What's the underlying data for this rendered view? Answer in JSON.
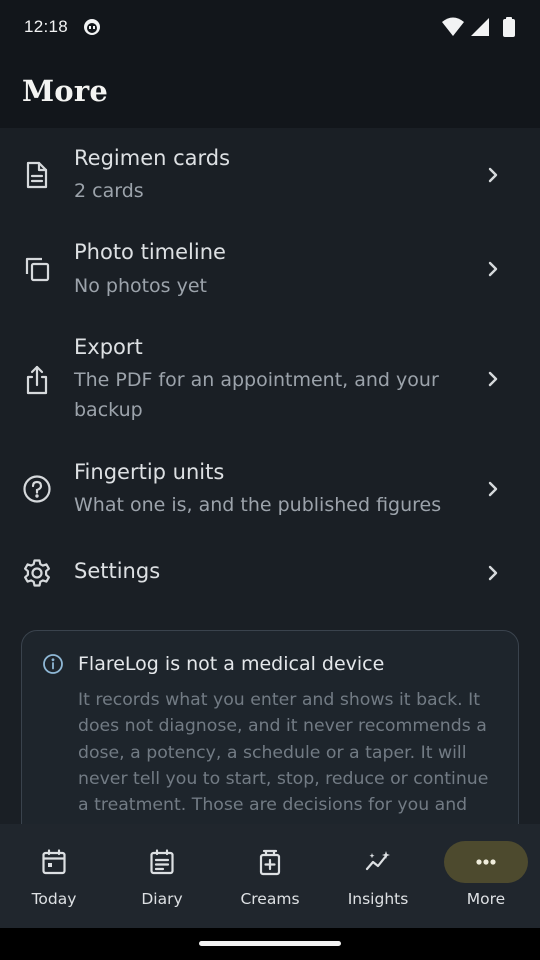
{
  "status_bar": {
    "time": "12:18",
    "icons": [
      "app-notification-icon",
      "wifi-icon",
      "cellular-signal-icon",
      "battery-icon"
    ]
  },
  "header": {
    "title": "More"
  },
  "menu": {
    "items": [
      {
        "title": "Regimen cards",
        "subtitle": "2 cards",
        "icon": "document-icon"
      },
      {
        "title": "Photo timeline",
        "subtitle": "No photos yet",
        "icon": "copy-stack-icon"
      },
      {
        "title": "Export",
        "subtitle": "The PDF for an appointment, and your backup",
        "icon": "share-upload-icon"
      },
      {
        "title": "Fingertip units",
        "subtitle": "What one is, and the published figures",
        "icon": "help-circle-icon"
      },
      {
        "title": "Settings",
        "subtitle": "",
        "icon": "gear-icon"
      }
    ]
  },
  "notice": {
    "title": "FlareLog is not a medical device",
    "body": "It records what you enter and shows it back. It does not diagnose, and it never recommends a dose, a potency, a schedule or a taper. It will never tell you to start, stop, reduce or continue a treatment. Those are decisions for you and",
    "icon": "info-icon"
  },
  "bottom_nav": {
    "items": [
      {
        "label": "Today",
        "icon": "calendar-today-icon",
        "selected": false
      },
      {
        "label": "Diary",
        "icon": "diary-icon",
        "selected": false
      },
      {
        "label": "Creams",
        "icon": "cream-tube-icon",
        "selected": false
      },
      {
        "label": "Insights",
        "icon": "insights-sparkle-icon",
        "selected": false
      },
      {
        "label": "More",
        "icon": "more-dots-icon",
        "selected": true
      }
    ]
  },
  "colors": {
    "background": "#12161b",
    "surface": "#1a1f25",
    "nav_background": "#20262d",
    "selected_pill": "#4d4a2e",
    "info_accent": "#8fb8d6",
    "text_primary": "#dde0e3",
    "text_secondary": "#9ca3ab"
  }
}
